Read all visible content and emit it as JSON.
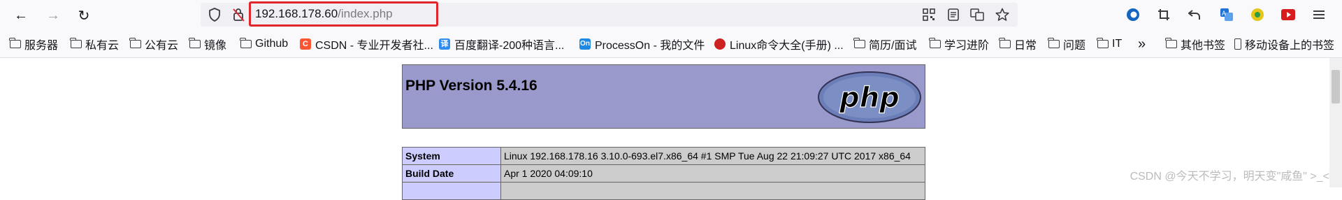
{
  "browser": {
    "nav": {
      "back_icon": "←",
      "forward_icon": "→",
      "reload_icon": "↻"
    },
    "url": {
      "host": "192.168.178.60",
      "path": "/index.php"
    },
    "toolbar_icons": [
      "shield-icon",
      "lock-off-icon",
      "qr-icon",
      "reader-icon",
      "translate-icon",
      "star-icon",
      "edge-icon",
      "crop-icon",
      "undo-icon",
      "translate-alt-icon",
      "extension-icon",
      "youtube-icon",
      "menu-icon"
    ]
  },
  "bookmarks": {
    "items": [
      {
        "label": "服务器",
        "type": "folder"
      },
      {
        "label": "私有云",
        "type": "folder"
      },
      {
        "label": "公有云",
        "type": "folder"
      },
      {
        "label": "镜像",
        "type": "folder"
      },
      {
        "label": "Github",
        "type": "folder"
      },
      {
        "label": "CSDN - 专业开发者社...",
        "type": "site",
        "icon": "C",
        "color": "#fc5531"
      },
      {
        "label": "百度翻译-200种语言...",
        "type": "site",
        "icon": "译",
        "color": "#2d8cf0"
      },
      {
        "label": "ProcessOn - 我的文件",
        "type": "site",
        "icon": "On",
        "color": "#1e88e5"
      },
      {
        "label": "Linux命令大全(手册) ...",
        "type": "site",
        "icon": "",
        "color": "#cc2222"
      },
      {
        "label": "简历/面试",
        "type": "folder"
      },
      {
        "label": "学习进阶",
        "type": "folder"
      },
      {
        "label": "日常",
        "type": "folder"
      },
      {
        "label": "问题",
        "type": "folder"
      },
      {
        "label": "IT",
        "type": "folder"
      }
    ],
    "overflow_icon": "»",
    "other_bookmarks": "其他书签",
    "mobile_bookmarks": "移动设备上的书签"
  },
  "page": {
    "title": "PHP Version 5.4.16",
    "logo_text": "php",
    "rows": [
      {
        "key": "System",
        "value": "Linux 192.168.178.16 3.10.0-693.el7.x86_64 #1 SMP Tue Aug 22 21:09:27 UTC 2017 x86_64"
      },
      {
        "key": "Build Date",
        "value": "Apr 1 2020 04:09:10"
      },
      {
        "key": "",
        "value": ""
      }
    ]
  },
  "watermark": "CSDN @今天不学习，明天变\"咸鱼\" >_<"
}
